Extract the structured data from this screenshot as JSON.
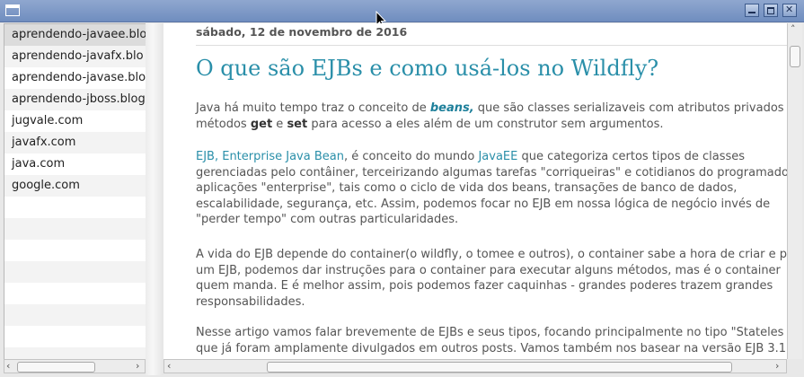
{
  "window": {
    "controls": {
      "minimize": "minimize",
      "maximize": "maximize",
      "close": "close"
    }
  },
  "sidebar": {
    "items": [
      {
        "label": "aprendendo-javaee.blo"
      },
      {
        "label": "aprendendo-javafx.blo"
      },
      {
        "label": "aprendendo-javase.blo"
      },
      {
        "label": "aprendendo-jboss.blog"
      },
      {
        "label": "jugvale.com"
      },
      {
        "label": "javafx.com"
      },
      {
        "label": "java.com"
      },
      {
        "label": "google.com"
      }
    ],
    "selected_index": 0
  },
  "post": {
    "date": "sábado, 12 de novembro de 2016",
    "title": "O que são EJBs e como usá-los no Wildfly?",
    "p1": {
      "l1a": "Java há muito tempo traz o conceito de ",
      "l1b": "beans,",
      "l1c": " que  são classes serializaveis com atributos privados",
      "l2a": "métodos ",
      "l2b": "get",
      "l2c": " e ",
      "l2d": "set",
      "l2e": " para acesso a eles além de um construtor sem argumentos."
    },
    "p2": {
      "l1a": "EJB, Enterprise Java Bean",
      "l1b": ", é conceito do mundo ",
      "l1c": "JavaEE",
      "l1d": " que categoriza certos tipos de classes",
      "l2": "gerenciadas pelo contâiner, terceirizando algumas tarefas \"corriqueiras\" e cotidianos do programado",
      "l3": "aplicações \"enterprise\", tais como o ciclo de vida dos beans, transações de banco de dados,",
      "l4": "escalabilidade, segurança, etc. Assim, podemos focar no EJB em nossa lógica de negócio invés de",
      "l5": "\"perder tempo\" com outras particularidades."
    },
    "p3": {
      "l1": " A vida do EJB depende do container(o wildfly, o tomee e outros), o container sabe a hora de criar e p",
      "l2": "um EJB, podemos dar instruções para o container para executar alguns métodos, mas é o container",
      "l3": "quem manda. E é melhor assim, pois podemos fazer caquinhas - grandes poderes trazem grandes",
      "l4": "responsabilidades."
    },
    "p4": {
      "l1": "Nesse artigo vamos falar brevemente de EJBs e seus tipos, focando principalmente no tipo \"Stateles",
      "l2": "que já foram amplamente divulgados em outros posts. Vamos também nos basear na versão EJB 3.1"
    }
  }
}
